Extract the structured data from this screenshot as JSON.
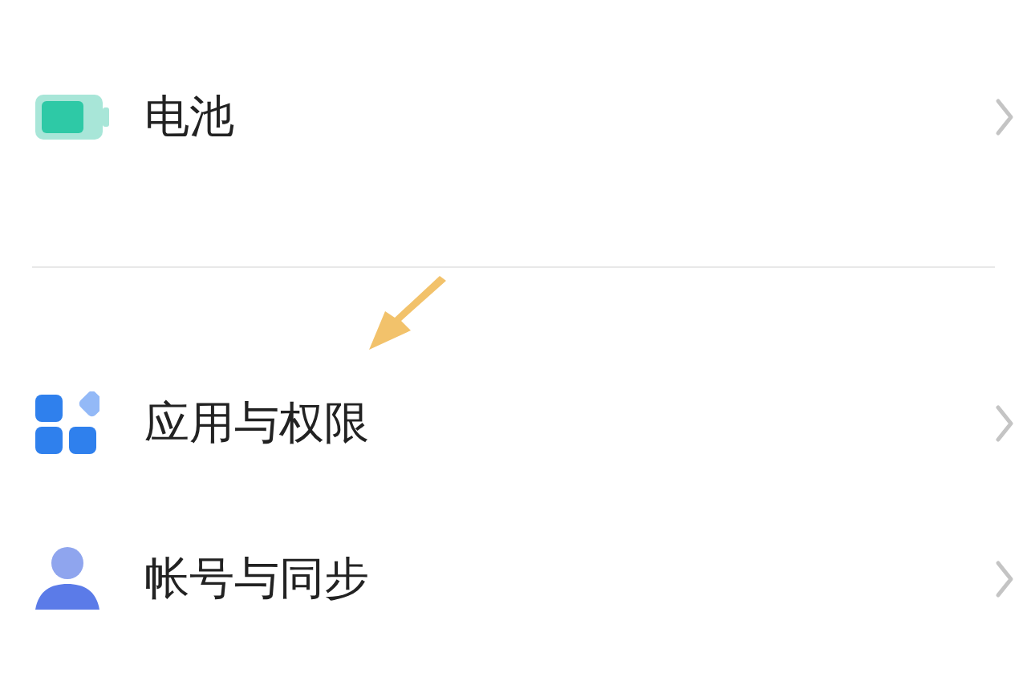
{
  "groups": [
    {
      "items": [
        {
          "kind": "battery",
          "label": "电池"
        }
      ]
    },
    {
      "items": [
        {
          "kind": "apps",
          "label": "应用与权限"
        },
        {
          "kind": "account",
          "label": "帐号与同步"
        }
      ]
    }
  ]
}
